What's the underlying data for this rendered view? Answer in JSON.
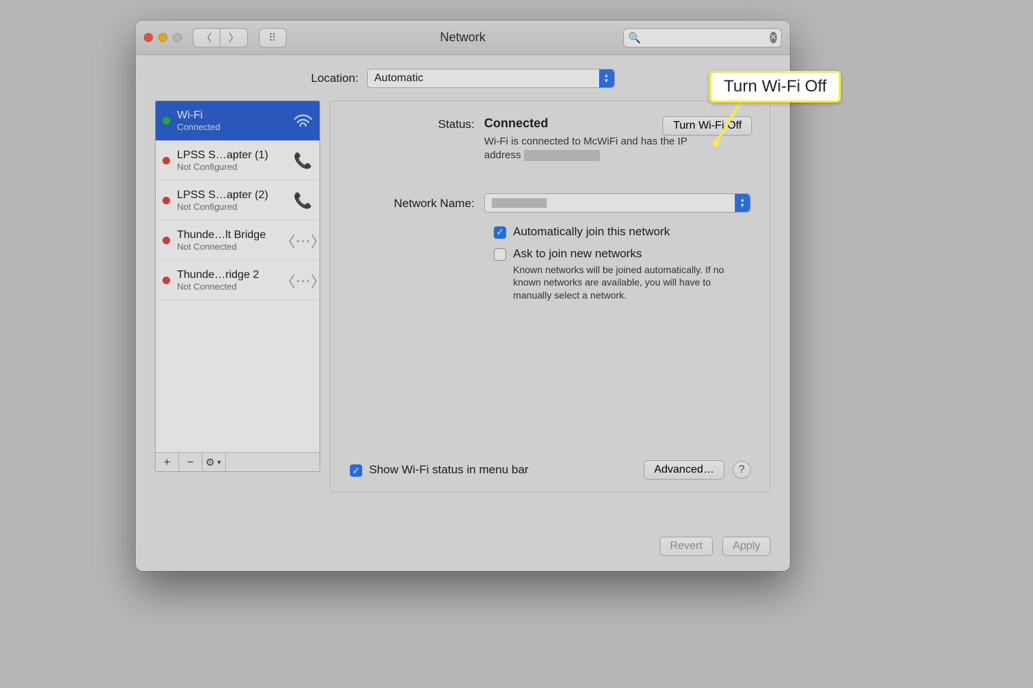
{
  "window": {
    "title": "Network"
  },
  "toolbar": {
    "search_placeholder": ""
  },
  "location": {
    "label": "Location:",
    "value": "Automatic"
  },
  "services": [
    {
      "name": "Wi-Fi",
      "status": "Connected",
      "dot": "green",
      "icon": "wifi",
      "selected": true
    },
    {
      "name": "LPSS S…apter (1)",
      "status": "Not Configured",
      "dot": "red",
      "icon": "phone",
      "selected": false
    },
    {
      "name": "LPSS S…apter (2)",
      "status": "Not Configured",
      "dot": "red",
      "icon": "phone",
      "selected": false
    },
    {
      "name": "Thunde…lt Bridge",
      "status": "Not Connected",
      "dot": "red",
      "icon": "bridge",
      "selected": false
    },
    {
      "name": "Thunde…ridge 2",
      "status": "Not Connected",
      "dot": "red",
      "icon": "bridge",
      "selected": false
    }
  ],
  "detail": {
    "status_label": "Status:",
    "status_value": "Connected",
    "status_desc_1": "Wi-Fi is connected to McWiFi and has the IP address ",
    "turn_off": "Turn Wi-Fi Off",
    "network_name_label": "Network Name:",
    "auto_join": "Automatically join this network",
    "ask_join": "Ask to join new networks",
    "ask_help": "Known networks will be joined automatically. If no known networks are available, you will have to manually select a network.",
    "show_menubar": "Show Wi-Fi status in menu bar",
    "advanced": "Advanced…"
  },
  "footer": {
    "revert": "Revert",
    "apply": "Apply"
  },
  "callout": {
    "text": "Turn Wi-Fi Off"
  }
}
